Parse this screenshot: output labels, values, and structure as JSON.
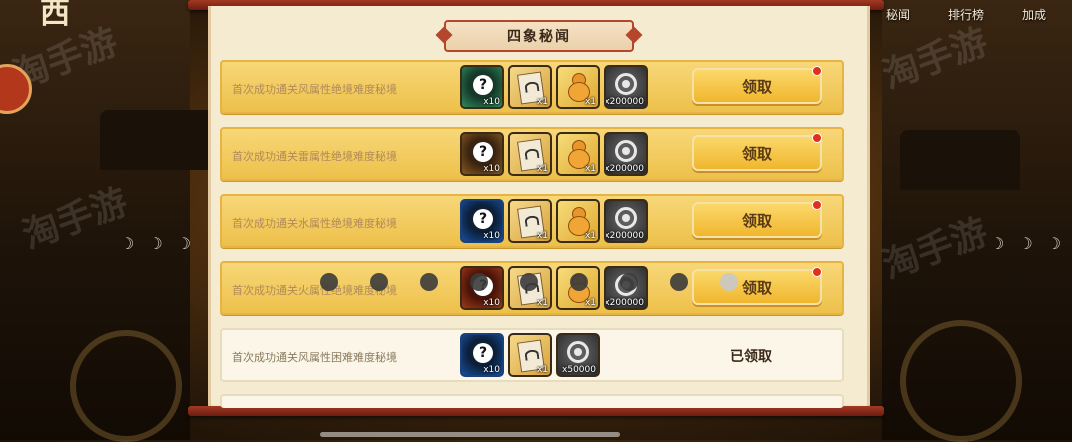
{
  "header": {
    "logo_text": "西",
    "nav": [
      {
        "label": "秘闻"
      },
      {
        "label": "排行榜"
      },
      {
        "label": "加成"
      }
    ]
  },
  "panel": {
    "title": "四象秘闻"
  },
  "quests": [
    {
      "description": "首次成功通关风属性绝境难度秘境",
      "rewards": [
        {
          "icon": "mystery-orb-icon",
          "qty": "x10"
        },
        {
          "icon": "scroll-icon",
          "qty": "x1"
        },
        {
          "icon": "gourd-icon",
          "qty": "x1"
        },
        {
          "icon": "coin-icon",
          "qty": "x200000"
        }
      ],
      "action": "领取",
      "has_notification": true
    },
    {
      "description": "首次成功通关雷属性绝境难度秘境",
      "rewards": [
        {
          "icon": "mystery-orb-icon",
          "qty": "x10"
        },
        {
          "icon": "scroll-icon",
          "qty": "x1"
        },
        {
          "icon": "gourd-icon",
          "qty": "x1"
        },
        {
          "icon": "coin-icon",
          "qty": "x200000"
        }
      ],
      "action": "领取",
      "has_notification": true
    },
    {
      "description": "首次成功通关水属性绝境难度秘境",
      "rewards": [
        {
          "icon": "mystery-orb-icon",
          "qty": "x10"
        },
        {
          "icon": "scroll-icon",
          "qty": "x1"
        },
        {
          "icon": "gourd-icon",
          "qty": "x1"
        },
        {
          "icon": "coin-icon",
          "qty": "x200000"
        }
      ],
      "action": "领取",
      "has_notification": true
    },
    {
      "description": "首次成功通关火属性绝境难度秘境",
      "rewards": [
        {
          "icon": "mystery-orb-icon",
          "qty": "x10"
        },
        {
          "icon": "scroll-icon",
          "qty": "x1"
        },
        {
          "icon": "gourd-icon",
          "qty": "x1"
        },
        {
          "icon": "coin-icon",
          "qty": "x200000"
        }
      ],
      "action": "领取",
      "has_notification": true
    },
    {
      "description": "首次成功通关风属性困难难度秘境",
      "rewards": [
        {
          "icon": "mystery-orb-icon",
          "qty": "x10"
        },
        {
          "icon": "scroll-icon",
          "qty": "x1"
        },
        {
          "icon": "coin-icon",
          "qty": "x50000"
        }
      ],
      "status": "已领取"
    }
  ],
  "watermark": "淘手游",
  "colors": {
    "row_gold": "#edc04a",
    "button_gold": "#f0b62e",
    "frame_red": "#a33a22",
    "notification_red": "#e0301e"
  }
}
